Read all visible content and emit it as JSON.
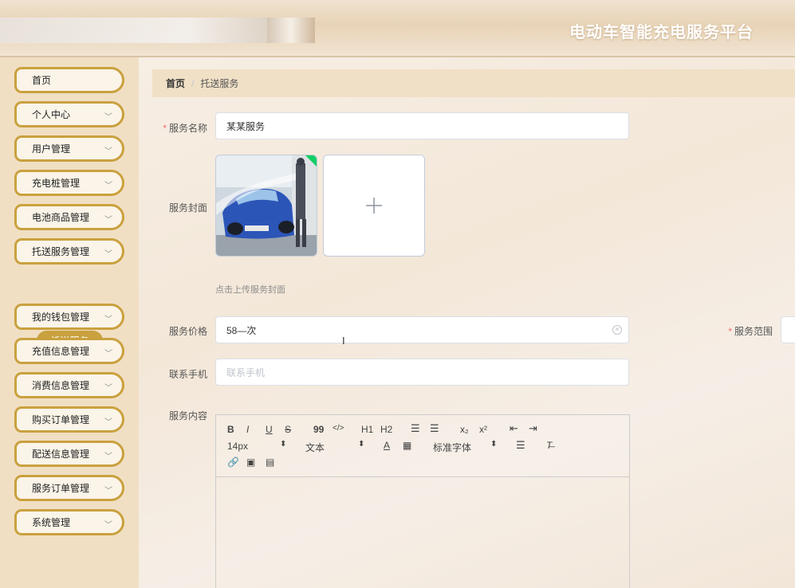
{
  "header": {
    "title": "电动车智能充电服务平台"
  },
  "sidebar": {
    "items": [
      {
        "label": "首页",
        "has_chevron": false
      },
      {
        "label": "个人中心",
        "has_chevron": true
      },
      {
        "label": "用户管理",
        "has_chevron": true
      },
      {
        "label": "充电桩管理",
        "has_chevron": true
      },
      {
        "label": "电池商品管理",
        "has_chevron": true
      },
      {
        "label": "托送服务管理",
        "has_chevron": true
      },
      {
        "label": "我的钱包管理",
        "has_chevron": true
      },
      {
        "label": "充值信息管理",
        "has_chevron": true
      },
      {
        "label": "消费信息管理",
        "has_chevron": true
      },
      {
        "label": "购买订单管理",
        "has_chevron": true
      },
      {
        "label": "配送信息管理",
        "has_chevron": true
      },
      {
        "label": "服务订单管理",
        "has_chevron": true
      },
      {
        "label": "系统管理",
        "has_chevron": true
      }
    ],
    "active_sub": "托送服务"
  },
  "breadcrumb": {
    "home": "首页",
    "separator": "/",
    "current": "托送服务"
  },
  "form": {
    "service_name": {
      "label": "服务名称",
      "required": true,
      "value": "某某服务"
    },
    "cover": {
      "label": "服务封面",
      "tip": "点击上传服务封面",
      "add_icon": "plus-icon"
    },
    "price": {
      "label": "服务价格",
      "value": "58—次"
    },
    "scope": {
      "label": "服务范围",
      "required": true
    },
    "phone": {
      "label": "联系手机",
      "placeholder": "联系手机"
    },
    "content": {
      "label": "服务内容"
    }
  },
  "editor_toolbar": {
    "row1": [
      "B",
      "I",
      "U",
      "S",
      "99",
      "</>",
      "H1",
      "H2",
      "ol",
      "ul",
      "x₂",
      "x²",
      "outdent",
      "indent"
    ],
    "font_size": "14px",
    "paragraph": "文本",
    "font_family": "标准字体",
    "row3": [
      "link",
      "image",
      "video"
    ]
  },
  "colors": {
    "accent": "#c9a13e",
    "required": "#f56c6c"
  }
}
